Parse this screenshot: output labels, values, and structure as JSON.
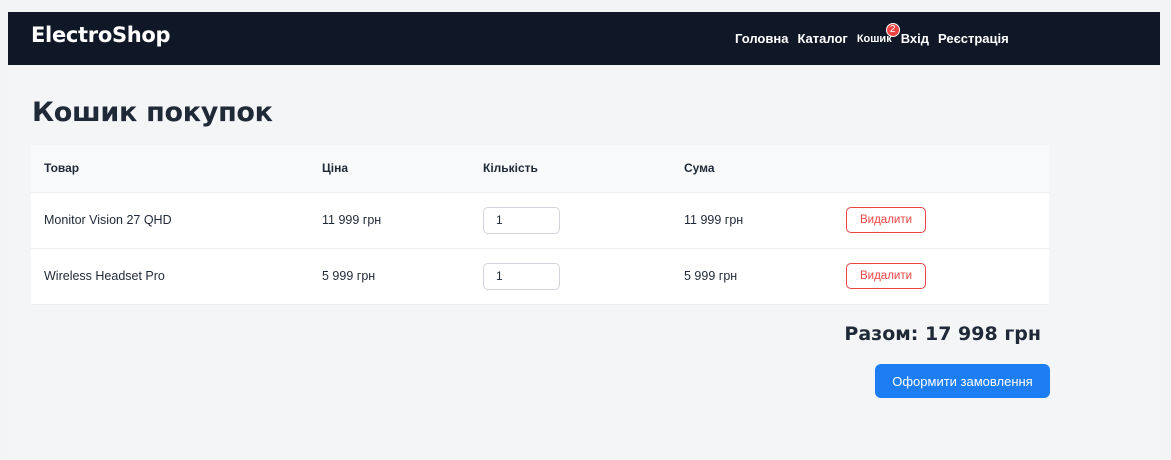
{
  "nav": {
    "brand": "ElectroShop",
    "links": [
      {
        "label": "Головна"
      },
      {
        "label": "Каталог"
      },
      {
        "label": "Кошик",
        "badge": "2"
      },
      {
        "label": "Вхід"
      },
      {
        "label": "Реєстрація"
      }
    ]
  },
  "page": {
    "title": "Кошик покупок"
  },
  "table": {
    "headers": [
      "Товар",
      "Ціна",
      "Кількість",
      "Сума",
      ""
    ],
    "rows": [
      {
        "product": "Monitor Vision 27 QHD",
        "price": "11 999 грн",
        "quantity": "1",
        "sum": "11 999 грн",
        "remove_label": "Видалити"
      },
      {
        "product": "Wireless Headset Pro",
        "price": "5 999 грн",
        "quantity": "1",
        "sum": "5 999 грн",
        "remove_label": "Видалити"
      }
    ]
  },
  "summary": {
    "total": "Разом: 17 998 грн",
    "checkout_label": "Оформити замовлення"
  },
  "colors": {
    "navbar": "#101828",
    "accent": "#1d7df2",
    "danger": "#ef4444"
  }
}
